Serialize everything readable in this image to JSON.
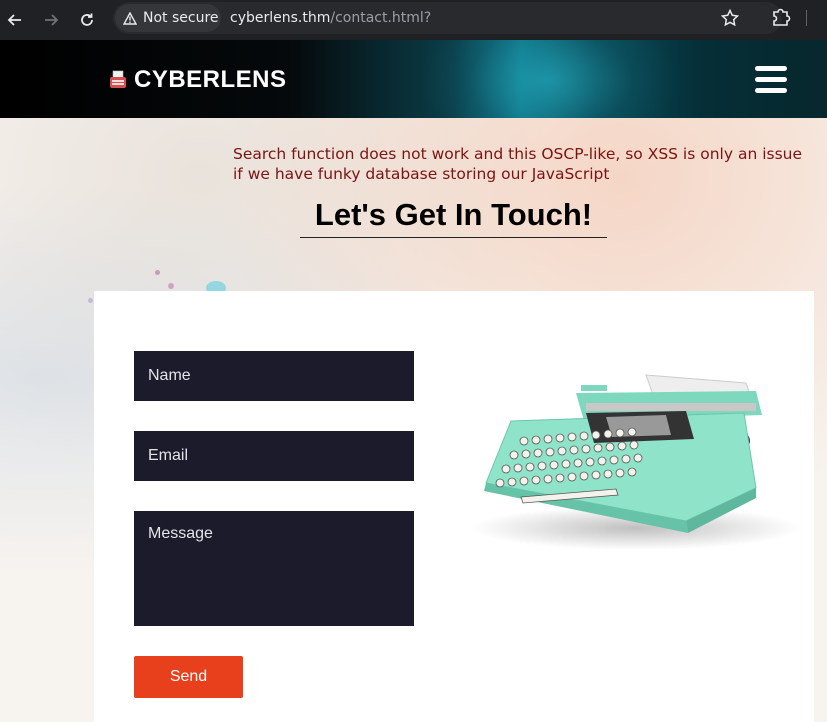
{
  "browser": {
    "security_label": "Not secure",
    "url_host": "cyberlens.thm",
    "url_path": "/contact.html?"
  },
  "site": {
    "brand": "CYBERLENS"
  },
  "notice_text": "Search function does not work and this OSCP-like, so XSS is only an issue if we have funky database storing our JavaScript",
  "contact": {
    "heading": "Let's Get In Touch!",
    "name_placeholder": "Name",
    "email_placeholder": "Email",
    "message_placeholder": "Message",
    "send_label": "Send"
  },
  "colors": {
    "notice_text": "#7a1414",
    "field_bg": "#1c1b2c",
    "send_button": "#e8401c",
    "typewriter_body": "#8fe3c8"
  }
}
